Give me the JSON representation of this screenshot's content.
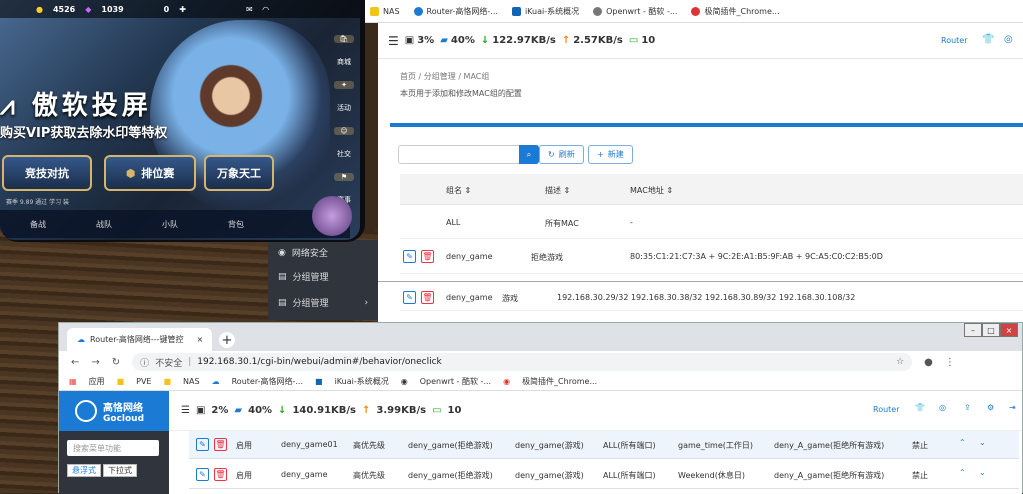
{
  "top_bookmarks": [
    {
      "label": "NAS",
      "color": "#f3c318"
    },
    {
      "label": "Router-高恪网络-...",
      "color": "#1a7ad4"
    },
    {
      "label": "iKuai-系统概况",
      "color": "#1464b4"
    },
    {
      "label": "Openwrt - 酷软 -...",
      "color": "#777"
    },
    {
      "label": "极简插件_Chrome...",
      "color": "#d33"
    }
  ],
  "router": {
    "cpu": "3%",
    "mem": "40%",
    "down": "122.97KB/s",
    "up": "2.57KB/s",
    "devices": "10",
    "right_label": "Router",
    "breadcrumb": "首页  /  分组管理  /  MAC组",
    "description": "本页用于添加和修改MAC组的配置",
    "refresh": "刷新",
    "new": "新建",
    "headers": [
      "组名",
      "描述",
      "MAC地址"
    ],
    "rows": [
      {
        "name": "ALL",
        "desc": "所有MAC",
        "mac": "-"
      },
      {
        "name": "deny_game",
        "desc": "拒绝游戏",
        "mac": "80:35:C1:21:C7:3A + 9C:2E:A1:B5:9F:AB + 9C:A5:C0:C2:B5:0D"
      }
    ],
    "ip_row": {
      "name": "deny_game",
      "desc": "游戏",
      "ips": "192.168.30.29/32   192.168.30.38/32   192.168.30.89/32   192.168.30.108/32"
    },
    "sidebar": [
      "网络安全",
      "分组管理",
      "分组管理"
    ]
  },
  "game": {
    "coins": "4526",
    "gems": "1039",
    "zero": "0",
    "brand": "傲软投屏",
    "promo": "购买VIP获取去除水印等特权",
    "modes": [
      "竞技对抗",
      "排位赛",
      "万象天工"
    ],
    "nav": [
      "备战",
      "战队",
      "小队",
      "背包"
    ],
    "side": [
      "商城",
      "活动",
      "社交",
      "赛事"
    ],
    "season": "赛季 9.89 通过 学习 装"
  },
  "chrome": {
    "tab_title": "Router-高恪网络---键管控",
    "insecure": "不安全",
    "url": "192.168.30.1/cgi-bin/webui/admin#/behavior/oneclick",
    "bookmarks": [
      "应用",
      "PVE",
      "NAS",
      "Router-高恪网络-...",
      "iKuai-系统概况",
      "Openwrt - 酷软 -...",
      "极简插件_Chrome..."
    ],
    "logo_cn": "高恪网络",
    "logo_en": "Gocloud",
    "menu_search": "搜索菜单功能",
    "mode1": "悬浮式",
    "mode2": "下拉式",
    "cpu": "2%",
    "mem": "40%",
    "down": "140.91KB/s",
    "up": "3.99KB/s",
    "devices": "10",
    "right_label": "Router",
    "rows": [
      [
        "启用",
        "deny_game01",
        "高优先级",
        "deny_game(拒绝游戏)",
        "deny_game(游戏)",
        "ALL(所有端口)",
        "game_time(工作日)",
        "deny_A_game(拒绝所有游戏)",
        "禁止"
      ],
      [
        "启用",
        "deny_game",
        "高优先级",
        "deny_game(拒绝游戏)",
        "deny_game(游戏)",
        "ALL(所有端口)",
        "Weekend(休息日)",
        "deny_A_game(拒绝所有游戏)",
        "禁止"
      ]
    ]
  }
}
